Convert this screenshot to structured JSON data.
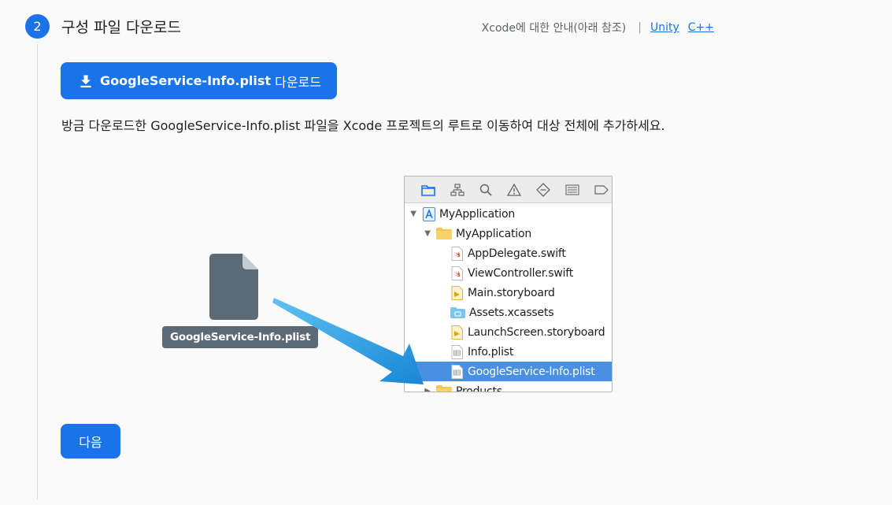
{
  "step": {
    "number": "2",
    "title": "구성 파일 다운로드"
  },
  "guide": {
    "text": "Xcode에 대한 안내(아래 참조)",
    "separator": "|",
    "links": [
      "Unity",
      "C++"
    ]
  },
  "download_button": {
    "icon": "download-icon",
    "filename": "GoogleService-Info.plist",
    "suffix": " 다운로드"
  },
  "description": "방금 다운로드한 GoogleService-Info.plist 파일을 Xcode 프로젝트의 루트로 이동하여 대상 전체에 추가하세요.",
  "file_badge": {
    "icon": "document-icon",
    "label": "GoogleService-Info.plist"
  },
  "xcode_navigator": {
    "toolbar_icons": [
      "folder-icon",
      "hierarchy-icon",
      "search-icon",
      "warning-icon",
      "diamond-icon",
      "list-icon",
      "tag-icon"
    ],
    "items": [
      {
        "label": "MyApplication",
        "icon": "xcode-project-icon",
        "disclosure": "open",
        "selected": false
      },
      {
        "label": "MyApplication",
        "icon": "folder-icon",
        "disclosure": "open",
        "selected": false
      },
      {
        "label": "AppDelegate.swift",
        "icon": "swift-file-icon",
        "disclosure": "none",
        "selected": false
      },
      {
        "label": "ViewController.swift",
        "icon": "swift-file-icon",
        "disclosure": "none",
        "selected": false
      },
      {
        "label": "Main.storyboard",
        "icon": "storyboard-icon",
        "disclosure": "none",
        "selected": false
      },
      {
        "label": "Assets.xcassets",
        "icon": "assets-folder-icon",
        "disclosure": "none",
        "selected": false
      },
      {
        "label": "LaunchScreen.storyboard",
        "icon": "storyboard-icon",
        "disclosure": "none",
        "selected": false
      },
      {
        "label": "Info.plist",
        "icon": "plist-icon",
        "disclosure": "none",
        "selected": false
      },
      {
        "label": "GoogleService-Info.plist",
        "icon": "plist-icon",
        "disclosure": "none",
        "selected": true
      },
      {
        "label": "Products",
        "icon": "folder-icon",
        "disclosure": "closed",
        "selected": false
      }
    ]
  },
  "next_button": {
    "label": "다음"
  },
  "colors": {
    "primary": "#1a73e8",
    "arrow": "#1e9be0",
    "selection": "#4a90e2",
    "file_badge": "#5b6a74"
  }
}
